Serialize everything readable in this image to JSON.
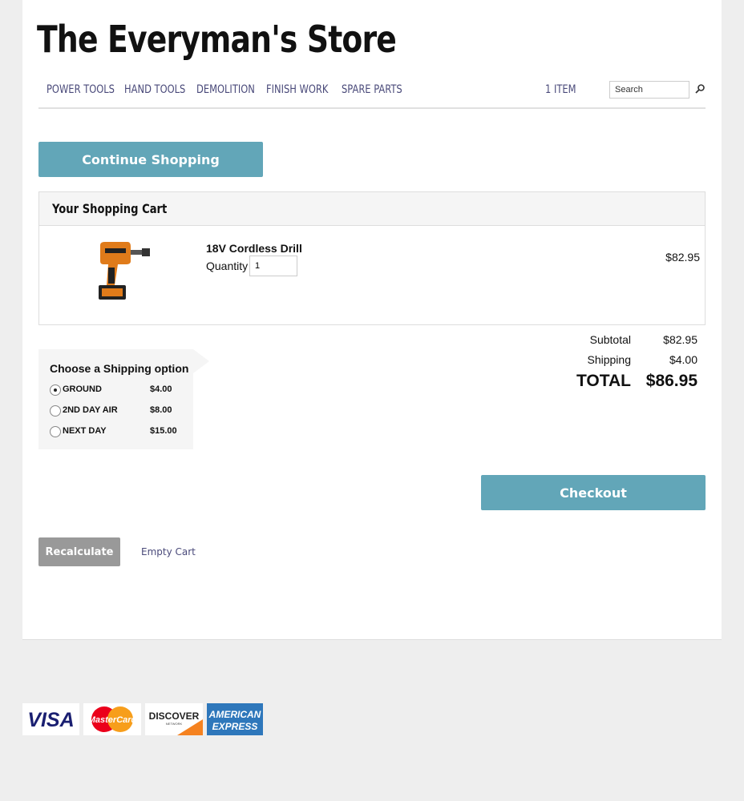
{
  "store": {
    "title": "The Everyman's Store"
  },
  "nav": {
    "items": [
      {
        "label": "POWER TOOLS"
      },
      {
        "label": "HAND TOOLS"
      },
      {
        "label": "DEMOLITION"
      },
      {
        "label": "FINISH WORK"
      },
      {
        "label": "SPARE PARTS"
      }
    ],
    "cart_count": "1  ITEM",
    "search_placeholder": "Search",
    "search_icon": "search-icon"
  },
  "buttons": {
    "continue_shopping": "Continue Shopping",
    "checkout": "Checkout",
    "recalculate": "Recalculate",
    "empty_cart": "Empty Cart"
  },
  "cart": {
    "heading": "Your Shopping Cart",
    "item": {
      "name": "18V Cordless Drill",
      "quantity_label": "Quantity",
      "quantity": "1",
      "price": "$82.95"
    }
  },
  "shipping": {
    "title": "Choose a Shipping option",
    "options": [
      {
        "label": "GROUND",
        "price": "$4.00",
        "selected": true
      },
      {
        "label": "2ND DAY AIR",
        "price": "$8.00",
        "selected": false
      },
      {
        "label": "NEXT DAY",
        "price": "$15.00",
        "selected": false
      }
    ]
  },
  "totals": {
    "subtotal_label": "Subtotal",
    "subtotal": "$82.95",
    "shipping_label": "Shipping",
    "shipping": "$4.00",
    "total_label": "TOTAL",
    "total": "$86.95"
  },
  "payment_cards": {
    "visa": "VISA",
    "mastercard": "MasterCard",
    "discover": "DISCOVER",
    "discover_sub": "NETWORK",
    "amex_line1": "AMERICAN",
    "amex_line2": "EXPRESS"
  },
  "colors": {
    "accent": "#62a6b8",
    "nav_text": "#4a4a7a",
    "button_gray": "#999999"
  }
}
